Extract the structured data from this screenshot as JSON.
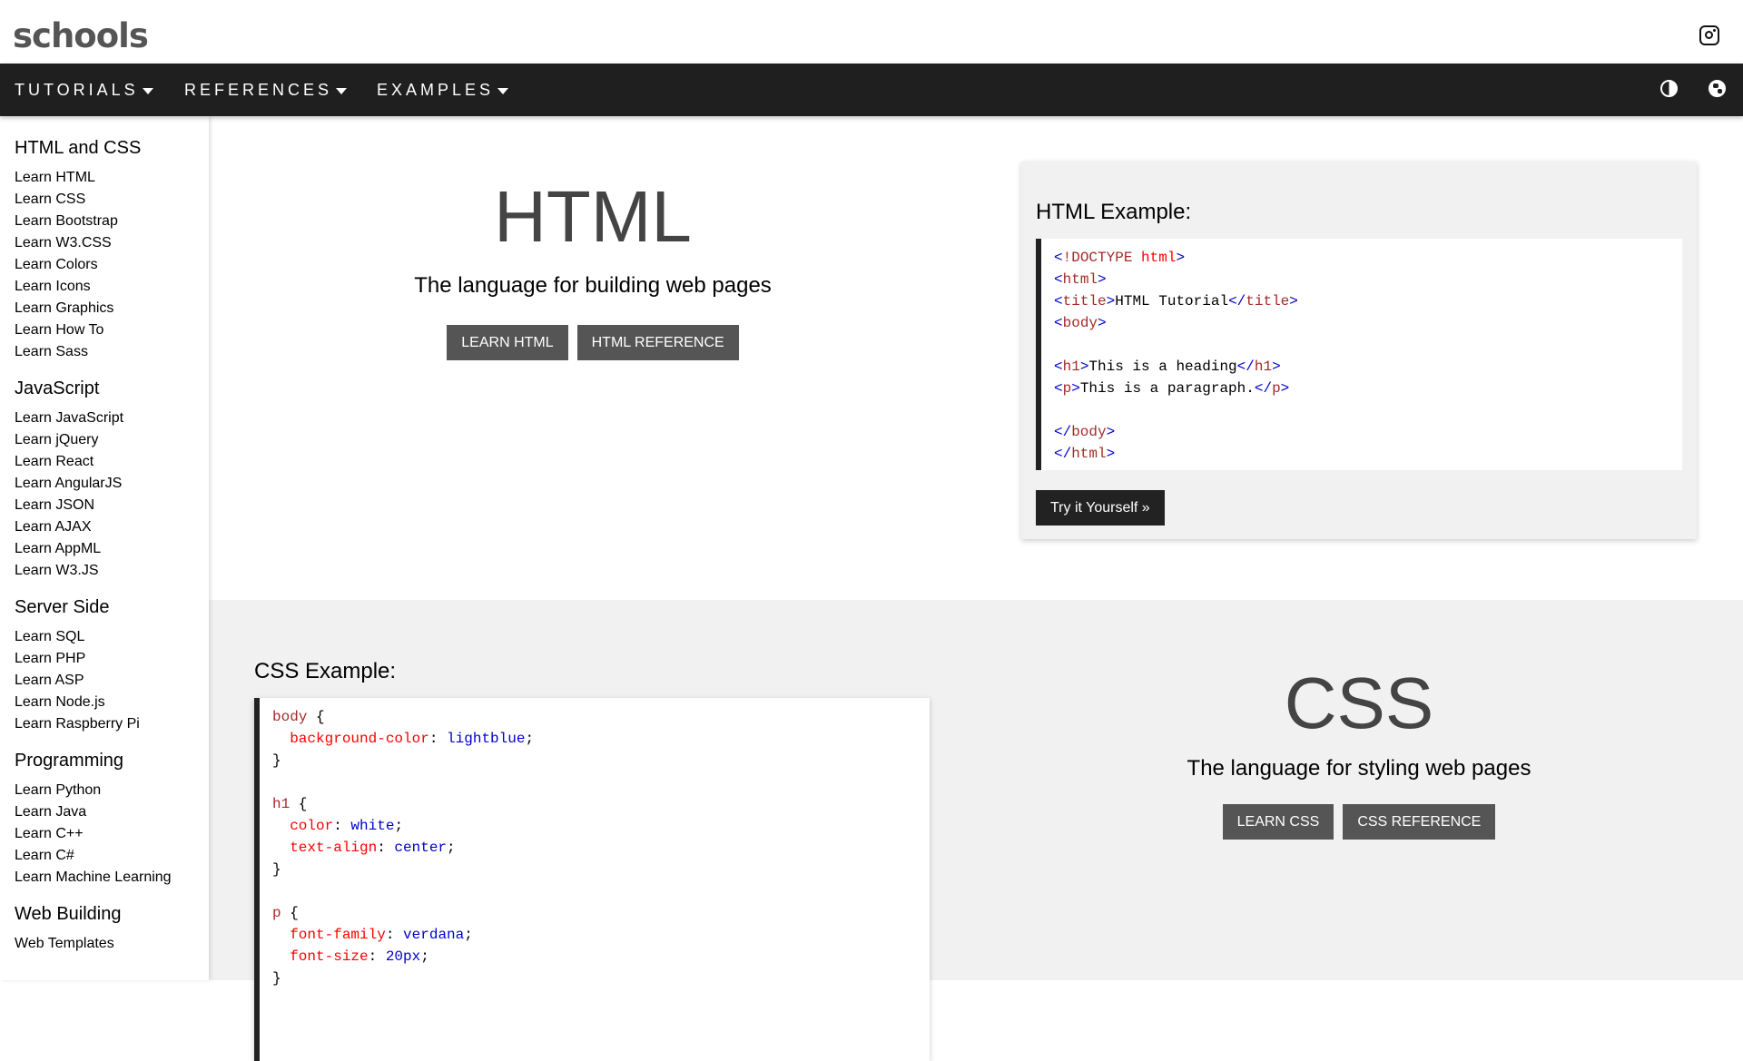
{
  "header": {
    "logo": "schools",
    "instagram_icon": "instagram-icon"
  },
  "nav": {
    "items": [
      "TUTORIALS",
      "REFERENCES",
      "EXAMPLES"
    ],
    "icons": [
      "contrast-icon",
      "globe-icon"
    ]
  },
  "sidebar": {
    "sections": [
      {
        "title": "HTML and CSS",
        "links": [
          "Learn HTML",
          "Learn CSS",
          "Learn Bootstrap",
          "Learn W3.CSS",
          "Learn Colors",
          "Learn Icons",
          "Learn Graphics",
          "Learn How To",
          "Learn Sass"
        ]
      },
      {
        "title": "JavaScript",
        "links": [
          "Learn JavaScript",
          "Learn jQuery",
          "Learn React",
          "Learn AngularJS",
          "Learn JSON",
          "Learn AJAX",
          "Learn AppML",
          "Learn W3.JS"
        ]
      },
      {
        "title": "Server Side",
        "links": [
          "Learn SQL",
          "Learn PHP",
          "Learn ASP",
          "Learn Node.js",
          "Learn Raspberry Pi"
        ]
      },
      {
        "title": "Programming",
        "links": [
          "Learn Python",
          "Learn Java",
          "Learn C++",
          "Learn C#",
          "Learn Machine Learning"
        ]
      },
      {
        "title": "Web Building",
        "links": [
          "Web Templates"
        ]
      }
    ]
  },
  "html_hero": {
    "title": "HTML",
    "subtitle": "The language for building web pages",
    "buttons": [
      "LEARN HTML",
      "HTML REFERENCE"
    ]
  },
  "html_example": {
    "heading": "HTML Example:",
    "try_button": "Try it Yourself »",
    "lines": [
      [
        [
          "tb",
          "<"
        ],
        [
          "tn",
          "!DOCTYPE "
        ],
        [
          "ta",
          "html"
        ],
        [
          "tb",
          ">"
        ]
      ],
      [
        [
          "tb",
          "<"
        ],
        [
          "tn",
          "html"
        ],
        [
          "tb",
          ">"
        ]
      ],
      [
        [
          "tb",
          "<"
        ],
        [
          "tn",
          "title"
        ],
        [
          "tb",
          ">"
        ],
        [
          "tt",
          "HTML Tutorial"
        ],
        [
          "tb",
          "</"
        ],
        [
          "tn",
          "title"
        ],
        [
          "tb",
          ">"
        ]
      ],
      [
        [
          "tb",
          "<"
        ],
        [
          "tn",
          "body"
        ],
        [
          "tb",
          ">"
        ]
      ],
      [],
      [
        [
          "tb",
          "<"
        ],
        [
          "tn",
          "h1"
        ],
        [
          "tb",
          ">"
        ],
        [
          "tt",
          "This is a heading"
        ],
        [
          "tb",
          "</"
        ],
        [
          "tn",
          "h1"
        ],
        [
          "tb",
          ">"
        ]
      ],
      [
        [
          "tb",
          "<"
        ],
        [
          "tn",
          "p"
        ],
        [
          "tb",
          ">"
        ],
        [
          "tt",
          "This is a paragraph."
        ],
        [
          "tb",
          "</"
        ],
        [
          "tn",
          "p"
        ],
        [
          "tb",
          ">"
        ]
      ],
      [],
      [
        [
          "tb",
          "</"
        ],
        [
          "tn",
          "body"
        ],
        [
          "tb",
          ">"
        ]
      ],
      [
        [
          "tb",
          "</"
        ],
        [
          "tn",
          "html"
        ],
        [
          "tb",
          ">"
        ]
      ]
    ]
  },
  "css_example": {
    "heading": "CSS Example:",
    "lines": [
      [
        [
          "cs",
          "body"
        ],
        [
          "tt",
          " {"
        ]
      ],
      [
        [
          "tt",
          "  "
        ],
        [
          "cp",
          "background-color"
        ],
        [
          "tt",
          ": "
        ],
        [
          "cv",
          "lightblue"
        ],
        [
          "tt",
          ";"
        ]
      ],
      [
        [
          "tt",
          "}"
        ]
      ],
      [],
      [
        [
          "cs",
          "h1"
        ],
        [
          "tt",
          " {"
        ]
      ],
      [
        [
          "tt",
          "  "
        ],
        [
          "cp",
          "color"
        ],
        [
          "tt",
          ": "
        ],
        [
          "cv",
          "white"
        ],
        [
          "tt",
          ";"
        ]
      ],
      [
        [
          "tt",
          "  "
        ],
        [
          "cp",
          "text-align"
        ],
        [
          "tt",
          ": "
        ],
        [
          "cv",
          "center"
        ],
        [
          "tt",
          ";"
        ]
      ],
      [
        [
          "tt",
          "}"
        ]
      ],
      [],
      [
        [
          "cs",
          "p"
        ],
        [
          "tt",
          " {"
        ]
      ],
      [
        [
          "tt",
          "  "
        ],
        [
          "cp",
          "font-family"
        ],
        [
          "tt",
          ": "
        ],
        [
          "cv",
          "verdana"
        ],
        [
          "tt",
          ";"
        ]
      ],
      [
        [
          "tt",
          "  "
        ],
        [
          "cp",
          "font-size"
        ],
        [
          "tt",
          ": "
        ],
        [
          "cv",
          "20px"
        ],
        [
          "tt",
          ";"
        ]
      ],
      [
        [
          "tt",
          "}"
        ]
      ]
    ]
  },
  "css_hero": {
    "title": "CSS",
    "subtitle": "The language for styling web pages",
    "buttons": [
      "LEARN CSS",
      "CSS REFERENCE"
    ]
  }
}
